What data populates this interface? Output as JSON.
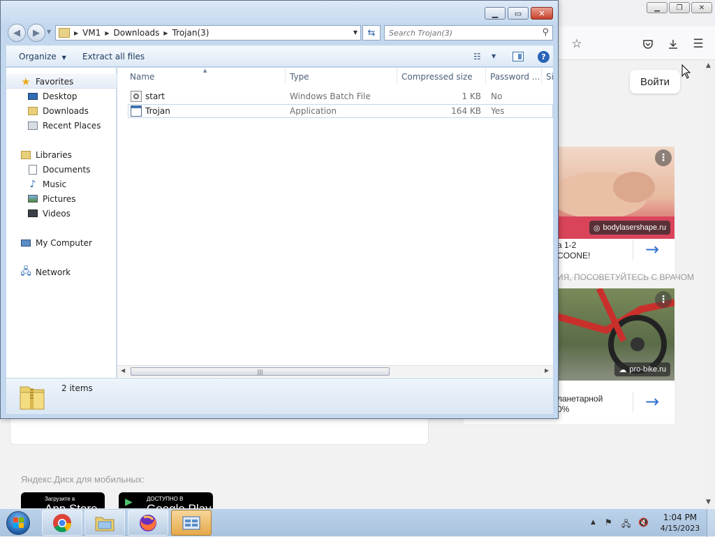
{
  "browser": {
    "login_button": "Войти",
    "ads": [
      {
        "source": "bodylasershape.ru",
        "text": "а 1-2\nCOONE!"
      },
      {
        "source": "pro-bike.ru",
        "text": "ланетарной\n0%"
      }
    ],
    "ad_warning": "ИЯ, ПОСОВЕТУЙТЕСЬ С ВРАЧОМ",
    "mobile_label": "Яндекс.Диск для мобильных:",
    "store_badges": [
      {
        "small": "Загрузите в",
        "big": "App Store"
      },
      {
        "small": "ДОСТУПНО В",
        "big": "Google Play"
      }
    ]
  },
  "explorer": {
    "breadcrumb": [
      "VM1",
      "Downloads",
      "Trojan(3)"
    ],
    "search_placeholder": "Search Trojan(3)",
    "commands": {
      "organize": "Organize",
      "extract": "Extract all files"
    },
    "nav": {
      "favorites": "Favorites",
      "desktop": "Desktop",
      "downloads": "Downloads",
      "recent": "Recent Places",
      "libraries": "Libraries",
      "documents": "Documents",
      "music": "Music",
      "pictures": "Pictures",
      "videos": "Videos",
      "computer": "My Computer",
      "network": "Network"
    },
    "columns": [
      "Name",
      "Type",
      "Compressed size",
      "Password ...",
      "Si"
    ],
    "files": [
      {
        "name": "start",
        "type": "Windows Batch File",
        "size": "1 KB",
        "password": "No"
      },
      {
        "name": "Trojan",
        "type": "Application",
        "size": "164 KB",
        "password": "Yes"
      }
    ],
    "items_count": "2 items"
  },
  "taskbar": {
    "time": "1:04 PM",
    "date": "4/15/2023"
  }
}
